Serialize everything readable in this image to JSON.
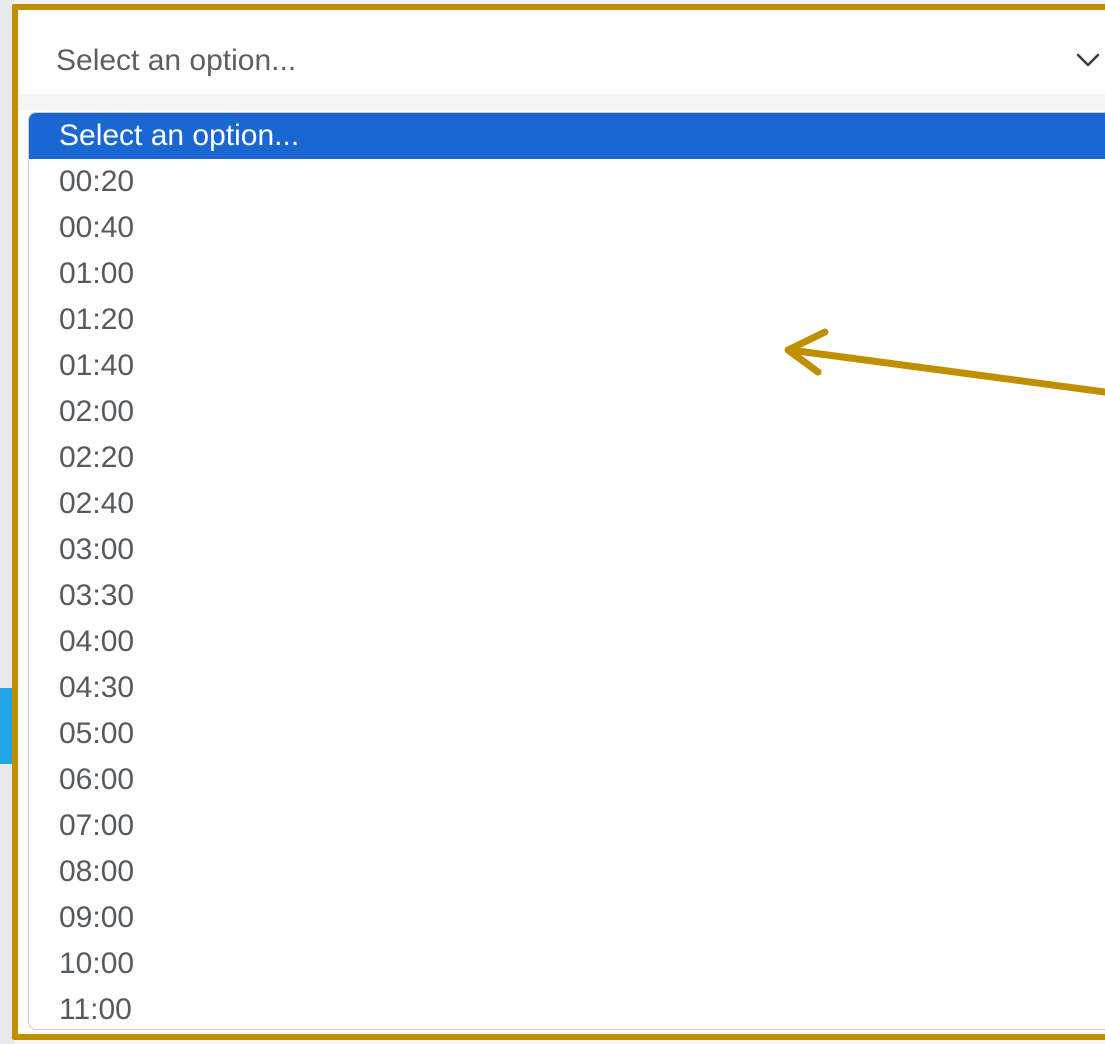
{
  "select": {
    "current_value": "Select an option...",
    "icon": "chevron-down-icon"
  },
  "dropdown": {
    "options": [
      {
        "label": "Select an option...",
        "selected": true
      },
      {
        "label": "00:20"
      },
      {
        "label": "00:40"
      },
      {
        "label": "01:00"
      },
      {
        "label": "01:20"
      },
      {
        "label": "01:40"
      },
      {
        "label": "02:00"
      },
      {
        "label": "02:20"
      },
      {
        "label": "02:40"
      },
      {
        "label": "03:00"
      },
      {
        "label": "03:30"
      },
      {
        "label": "04:00"
      },
      {
        "label": "04:30"
      },
      {
        "label": "05:00"
      },
      {
        "label": "06:00"
      },
      {
        "label": "07:00"
      },
      {
        "label": "08:00"
      },
      {
        "label": "09:00"
      },
      {
        "label": "10:00"
      },
      {
        "label": "11:00"
      }
    ]
  },
  "annotation": {
    "highlight_color": "#bf8f00",
    "selected_color": "#1a67d2"
  }
}
